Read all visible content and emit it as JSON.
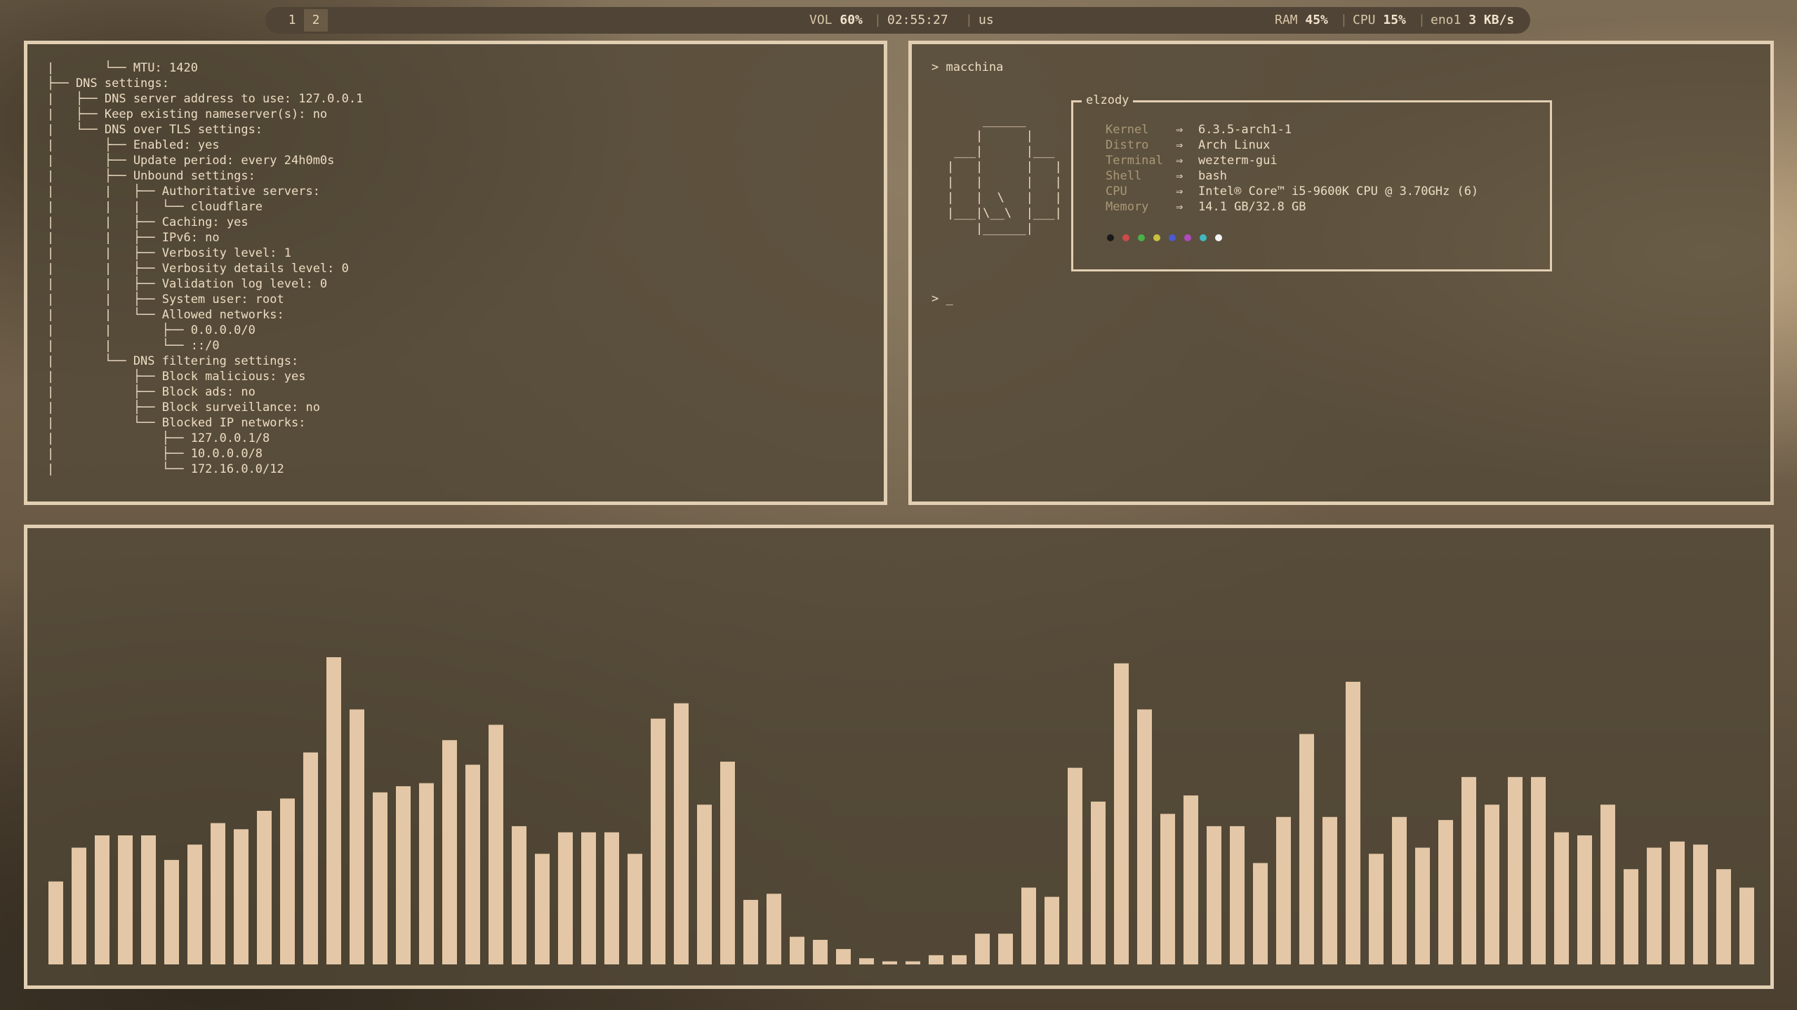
{
  "topbar": {
    "workspaces": [
      "1",
      "2"
    ],
    "active_workspace": "2",
    "volume_label": "VOL",
    "volume_value": "60%",
    "time": "02:55:27",
    "keyboard_layout": "us",
    "ram_label": "RAM",
    "ram_value": "45%",
    "cpu_label": "CPU",
    "cpu_value": "15%",
    "net_iface": "eno1",
    "net_speed": "3 KB/s",
    "separator": "|"
  },
  "left_terminal": {
    "lines": [
      "|       └── MTU: 1420",
      "├── DNS settings:",
      "|   ├── DNS server address to use: 127.0.0.1",
      "|   ├── Keep existing nameserver(s): no",
      "|   └── DNS over TLS settings:",
      "|       ├── Enabled: yes",
      "|       ├── Update period: every 24h0m0s",
      "|       ├── Unbound settings:",
      "|       |   ├── Authoritative servers:",
      "|       |   |   └── cloudflare",
      "|       |   ├── Caching: yes",
      "|       |   ├── IPv6: no",
      "|       |   ├── Verbosity level: 1",
      "|       |   ├── Verbosity details level: 0",
      "|       |   ├── Validation log level: 0",
      "|       |   ├── System user: root",
      "|       |   └── Allowed networks:",
      "|       |       ├── 0.0.0.0/0",
      "|       |       └── ::/0",
      "|       └── DNS filtering settings:",
      "|           ├── Block malicious: yes",
      "|           ├── Block ads: no",
      "|           ├── Block surveillance: no",
      "|           └── Blocked IP networks:",
      "|               ├── 127.0.0.1/8",
      "|               ├── 10.0.0.0/8",
      "|               └── 172.16.0.0/12"
    ]
  },
  "right_terminal": {
    "command": "> macchina",
    "prompt": "> _",
    "ascii_logo": "     ______\n    |      |\n ___|      |___\n|   |      |   |\n|   |      |   |\n|   |  \\   |   |\n|___|\\__\\  |___|\n    |______|",
    "box_title": "elzody",
    "arrow": "⇒",
    "info": [
      {
        "key": "Kernel",
        "value": "6.3.5-arch1-1"
      },
      {
        "key": "Distro",
        "value": "Arch Linux"
      },
      {
        "key": "Terminal",
        "value": "wezterm-gui"
      },
      {
        "key": "Shell",
        "value": "bash"
      },
      {
        "key": "CPU",
        "value": "Intel® Core™ i5-9600K CPU @ 3.70GHz (6)"
      },
      {
        "key": "Memory",
        "value": "14.1 GB/32.8 GB"
      }
    ],
    "palette": [
      "#1a1a1a",
      "#d04a4a",
      "#4ab04a",
      "#c8c040",
      "#4a5ad0",
      "#b04ac0",
      "#40b8c0",
      "#f4f4f4"
    ]
  },
  "visualizer": {
    "bar_color": "#e3c7a6",
    "levels": [
      0.27,
      0.38,
      0.42,
      0.42,
      0.42,
      0.34,
      0.39,
      0.46,
      0.44,
      0.5,
      0.54,
      0.69,
      1.0,
      0.83,
      0.56,
      0.58,
      0.59,
      0.73,
      0.65,
      0.78,
      0.45,
      0.36,
      0.43,
      0.43,
      0.43,
      0.36,
      0.8,
      0.85,
      0.52,
      0.66,
      0.21,
      0.23,
      0.09,
      0.08,
      0.05,
      0.02,
      0.01,
      0.01,
      0.03,
      0.03,
      0.1,
      0.1,
      0.25,
      0.22,
      0.64,
      0.53,
      0.98,
      0.83,
      0.49,
      0.55,
      0.45,
      0.45,
      0.33,
      0.48,
      0.75,
      0.48,
      0.92,
      0.36,
      0.48,
      0.38,
      0.47,
      0.61,
      0.52,
      0.61,
      0.61,
      0.43,
      0.42,
      0.52,
      0.31,
      0.38,
      0.4,
      0.39,
      0.31,
      0.25
    ]
  }
}
